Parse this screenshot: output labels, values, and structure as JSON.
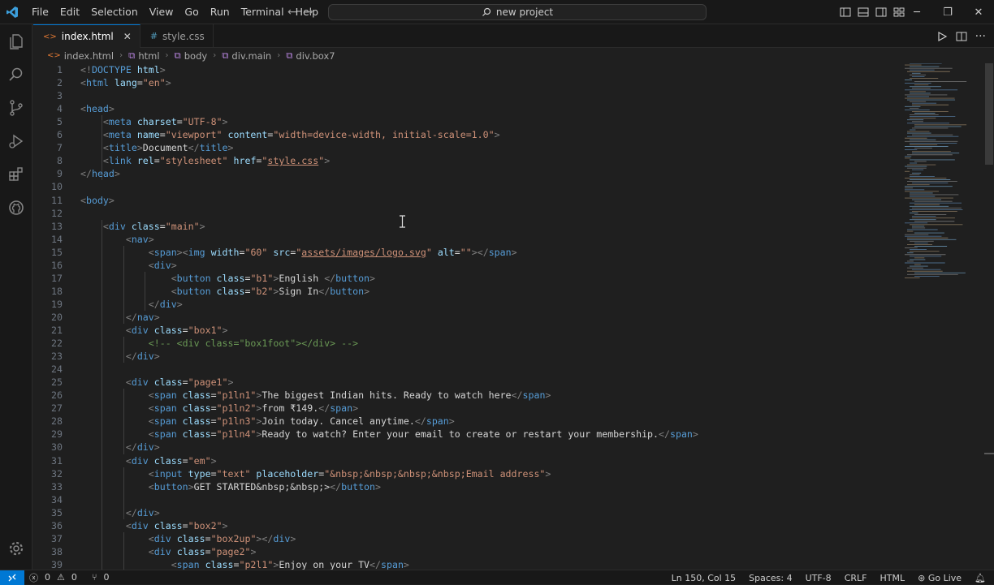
{
  "menu": [
    "File",
    "Edit",
    "Selection",
    "View",
    "Go",
    "Run",
    "Terminal",
    "Help"
  ],
  "command_center": "new project",
  "tabs": [
    {
      "label": "index.html",
      "active": true,
      "icon": "html-file-icon"
    },
    {
      "label": "style.css",
      "active": false,
      "icon": "css-file-icon"
    }
  ],
  "breadcrumb": [
    "index.html",
    "html",
    "body",
    "div.main",
    "div.box7"
  ],
  "code_lines": [
    {
      "n": "1",
      "html": "<span class=\"p\">&lt;!</span><span class=\"t\">DOCTYPE</span> <span class=\"a\">html</span><span class=\"p\">&gt;</span>"
    },
    {
      "n": "2",
      "html": "<span class=\"p\">&lt;</span><span class=\"t\">html</span> <span class=\"a\">lang</span><span class=\"x\">=</span><span class=\"s\">\"en\"</span><span class=\"p\">&gt;</span>"
    },
    {
      "n": "3",
      "html": ""
    },
    {
      "n": "4",
      "html": "<span class=\"p\">&lt;</span><span class=\"t\">head</span><span class=\"p\">&gt;</span>"
    },
    {
      "n": "5",
      "html": "    <span class=\"p\">&lt;</span><span class=\"t\">meta</span> <span class=\"a\">charset</span><span class=\"x\">=</span><span class=\"s\">\"UTF-8\"</span><span class=\"p\">&gt;</span>"
    },
    {
      "n": "6",
      "html": "    <span class=\"p\">&lt;</span><span class=\"t\">meta</span> <span class=\"a\">name</span><span class=\"x\">=</span><span class=\"s\">\"viewport\"</span> <span class=\"a\">content</span><span class=\"x\">=</span><span class=\"s\">\"width=device-width, initial-scale=1.0\"</span><span class=\"p\">&gt;</span>"
    },
    {
      "n": "7",
      "html": "    <span class=\"p\">&lt;</span><span class=\"t\">title</span><span class=\"p\">&gt;</span><span class=\"x\">Document</span><span class=\"p\">&lt;/</span><span class=\"t\">title</span><span class=\"p\">&gt;</span>"
    },
    {
      "n": "8",
      "html": "    <span class=\"p\">&lt;</span><span class=\"t\">link</span> <span class=\"a\">rel</span><span class=\"x\">=</span><span class=\"s\">\"stylesheet\"</span> <span class=\"a\">href</span><span class=\"x\">=</span><span class=\"s\">\"<span class=\"u\">style.css</span>\"</span><span class=\"p\">&gt;</span>"
    },
    {
      "n": "9",
      "html": "<span class=\"p\">&lt;/</span><span class=\"t\">head</span><span class=\"p\">&gt;</span>"
    },
    {
      "n": "10",
      "html": ""
    },
    {
      "n": "11",
      "html": "<span class=\"p\">&lt;</span><span class=\"t\">body</span><span class=\"p\">&gt;</span>"
    },
    {
      "n": "12",
      "html": ""
    },
    {
      "n": "13",
      "html": "    <span class=\"p\">&lt;</span><span class=\"t\">div</span> <span class=\"a\">class</span><span class=\"x\">=</span><span class=\"s\">\"main\"</span><span class=\"p\">&gt;</span>"
    },
    {
      "n": "14",
      "html": "        <span class=\"p\">&lt;</span><span class=\"t\">nav</span><span class=\"p\">&gt;</span>"
    },
    {
      "n": "15",
      "html": "            <span class=\"p\">&lt;</span><span class=\"t\">span</span><span class=\"p\">&gt;&lt;</span><span class=\"t\">img</span> <span class=\"a\">width</span><span class=\"x\">=</span><span class=\"s\">\"60\"</span> <span class=\"a\">src</span><span class=\"x\">=</span><span class=\"s\">\"<span class=\"u\">assets/images/logo.svg</span>\"</span> <span class=\"a\">alt</span><span class=\"x\">=</span><span class=\"s\">\"\"</span><span class=\"p\">&gt;&lt;/</span><span class=\"t\">span</span><span class=\"p\">&gt;</span>"
    },
    {
      "n": "16",
      "html": "            <span class=\"p\">&lt;</span><span class=\"t\">div</span><span class=\"p\">&gt;</span>"
    },
    {
      "n": "17",
      "html": "                <span class=\"p\">&lt;</span><span class=\"t\">button</span> <span class=\"a\">class</span><span class=\"x\">=</span><span class=\"s\">\"b1\"</span><span class=\"p\">&gt;</span><span class=\"x\">English </span><span class=\"p\">&lt;/</span><span class=\"t\">button</span><span class=\"p\">&gt;</span>"
    },
    {
      "n": "18",
      "html": "                <span class=\"p\">&lt;</span><span class=\"t\">button</span> <span class=\"a\">class</span><span class=\"x\">=</span><span class=\"s\">\"b2\"</span><span class=\"p\">&gt;</span><span class=\"x\">Sign In</span><span class=\"p\">&lt;/</span><span class=\"t\">button</span><span class=\"p\">&gt;</span>"
    },
    {
      "n": "19",
      "html": "            <span class=\"p\">&lt;/</span><span class=\"t\">div</span><span class=\"p\">&gt;</span>"
    },
    {
      "n": "20",
      "html": "        <span class=\"p\">&lt;/</span><span class=\"t\">nav</span><span class=\"p\">&gt;</span>"
    },
    {
      "n": "21",
      "html": "        <span class=\"p\">&lt;</span><span class=\"t\">div</span> <span class=\"a\">class</span><span class=\"x\">=</span><span class=\"s\">\"box1\"</span><span class=\"p\">&gt;</span>"
    },
    {
      "n": "22",
      "html": "            <span class=\"c\">&lt;!-- &lt;div class=\"box1foot\"&gt;&lt;/div&gt; --&gt;</span>"
    },
    {
      "n": "23",
      "html": "        <span class=\"p\">&lt;/</span><span class=\"t\">div</span><span class=\"p\">&gt;</span>"
    },
    {
      "n": "24",
      "html": ""
    },
    {
      "n": "25",
      "html": "        <span class=\"p\">&lt;</span><span class=\"t\">div</span> <span class=\"a\">class</span><span class=\"x\">=</span><span class=\"s\">\"page1\"</span><span class=\"p\">&gt;</span>"
    },
    {
      "n": "26",
      "html": "            <span class=\"p\">&lt;</span><span class=\"t\">span</span> <span class=\"a\">class</span><span class=\"x\">=</span><span class=\"s\">\"p1ln1\"</span><span class=\"p\">&gt;</span><span class=\"x\">The biggest Indian hits. Ready to watch here</span><span class=\"p\">&lt;/</span><span class=\"t\">span</span><span class=\"p\">&gt;</span>"
    },
    {
      "n": "27",
      "html": "            <span class=\"p\">&lt;</span><span class=\"t\">span</span> <span class=\"a\">class</span><span class=\"x\">=</span><span class=\"s\">\"p1ln2\"</span><span class=\"p\">&gt;</span><span class=\"x\">from ₹149.</span><span class=\"p\">&lt;/</span><span class=\"t\">span</span><span class=\"p\">&gt;</span>"
    },
    {
      "n": "28",
      "html": "            <span class=\"p\">&lt;</span><span class=\"t\">span</span> <span class=\"a\">class</span><span class=\"x\">=</span><span class=\"s\">\"p1ln3\"</span><span class=\"p\">&gt;</span><span class=\"x\">Join today. Cancel anytime.</span><span class=\"p\">&lt;/</span><span class=\"t\">span</span><span class=\"p\">&gt;</span>"
    },
    {
      "n": "29",
      "html": "            <span class=\"p\">&lt;</span><span class=\"t\">span</span> <span class=\"a\">class</span><span class=\"x\">=</span><span class=\"s\">\"p1ln4\"</span><span class=\"p\">&gt;</span><span class=\"x\">Ready to watch? Enter your email to create or restart your membership.</span><span class=\"p\">&lt;/</span><span class=\"t\">span</span><span class=\"p\">&gt;</span>"
    },
    {
      "n": "30",
      "html": "        <span class=\"p\">&lt;/</span><span class=\"t\">div</span><span class=\"p\">&gt;</span>"
    },
    {
      "n": "31",
      "html": "        <span class=\"p\">&lt;</span><span class=\"t\">div</span> <span class=\"a\">class</span><span class=\"x\">=</span><span class=\"s\">\"em\"</span><span class=\"p\">&gt;</span>"
    },
    {
      "n": "32",
      "html": "            <span class=\"p\">&lt;</span><span class=\"t\">input</span> <span class=\"a\">type</span><span class=\"x\">=</span><span class=\"s\">\"text\"</span> <span class=\"a\">placeholder</span><span class=\"x\">=</span><span class=\"s\">\"&amp;nbsp;&amp;nbsp;&amp;nbsp;&amp;nbsp;Email address\"</span><span class=\"p\">&gt;</span>"
    },
    {
      "n": "33",
      "html": "            <span class=\"p\">&lt;</span><span class=\"t\">button</span><span class=\"p\">&gt;</span><span class=\"x\">GET STARTED&amp;nbsp;&amp;nbsp;&gt;</span><span class=\"p\">&lt;/</span><span class=\"t\">button</span><span class=\"p\">&gt;</span>"
    },
    {
      "n": "34",
      "html": ""
    },
    {
      "n": "35",
      "html": "        <span class=\"p\">&lt;/</span><span class=\"t\">div</span><span class=\"p\">&gt;</span>"
    },
    {
      "n": "36",
      "html": "        <span class=\"p\">&lt;</span><span class=\"t\">div</span> <span class=\"a\">class</span><span class=\"x\">=</span><span class=\"s\">\"box2\"</span><span class=\"p\">&gt;</span>"
    },
    {
      "n": "37",
      "html": "            <span class=\"p\">&lt;</span><span class=\"t\">div</span> <span class=\"a\">class</span><span class=\"x\">=</span><span class=\"s\">\"box2up\"</span><span class=\"p\">&gt;&lt;/</span><span class=\"t\">div</span><span class=\"p\">&gt;</span>"
    },
    {
      "n": "38",
      "html": "            <span class=\"p\">&lt;</span><span class=\"t\">div</span> <span class=\"a\">class</span><span class=\"x\">=</span><span class=\"s\">\"page2\"</span><span class=\"p\">&gt;</span>"
    },
    {
      "n": "39",
      "html": "                <span class=\"p\">&lt;</span><span class=\"t\">span</span> <span class=\"a\">class</span><span class=\"x\">=</span><span class=\"s\">\"p2l1\"</span><span class=\"p\">&gt;</span><span class=\"x\">Enjoy on your TV</span><span class=\"p\">&lt;/</span><span class=\"t\">span</span><span class=\"p\">&gt;</span>"
    }
  ],
  "status": {
    "errors": "0",
    "warnings": "0",
    "ports": "0",
    "position": "Ln 150, Col 15",
    "spaces": "Spaces: 4",
    "encoding": "UTF-8",
    "eol": "CRLF",
    "language": "HTML",
    "golive": "Go Live"
  },
  "colors": {
    "accent": "#0078d4",
    "tag": "#569cd6",
    "attr": "#9cdcfe",
    "string": "#ce9178",
    "comment": "#6a9955"
  }
}
